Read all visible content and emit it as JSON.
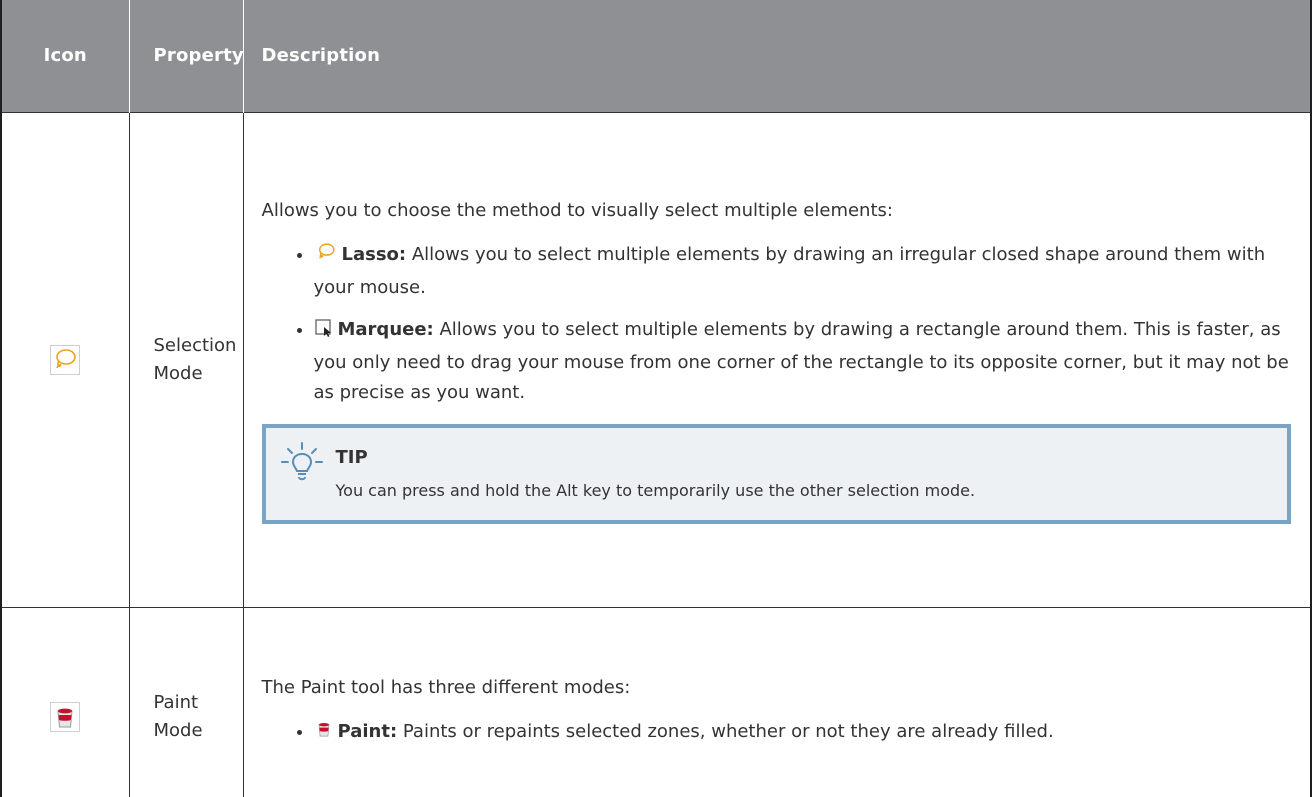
{
  "headers": {
    "icon": "Icon",
    "property": "Property",
    "description": "Description"
  },
  "rows": [
    {
      "icon": "lasso-icon",
      "property": "Selection Mode",
      "intro": "Allows you to choose the method to visually select multiple elements:",
      "items": [
        {
          "icon": "lasso-icon",
          "label": "Lasso:",
          "text": " Allows you to select multiple elements by drawing an irregular closed shape around them with your mouse."
        },
        {
          "icon": "marquee-icon",
          "label": "Marquee:",
          "text": " Allows you to select multiple elements by drawing a rectangle around them. This is faster, as you only need to drag your mouse from one corner of the rectangle to its opposite corner, but it may not be as precise as you want."
        }
      ],
      "tip": {
        "title": "TIP",
        "text": "You can press and hold the Alt key to temporarily use the other selection mode."
      }
    },
    {
      "icon": "paint-bucket-icon",
      "property": "Paint Mode",
      "intro": "The Paint tool has three different modes:",
      "items": [
        {
          "icon": "paint-bucket-icon",
          "label": "Paint:",
          "text": " Paints or repaints selected zones, whether or not they are already filled."
        }
      ]
    }
  ],
  "colors": {
    "header_bg": "#8e9093",
    "tip_border": "#7aa4c4",
    "tip_bg": "#edf1f4",
    "lasso": "#f0a020",
    "paint": "#c8102e"
  }
}
